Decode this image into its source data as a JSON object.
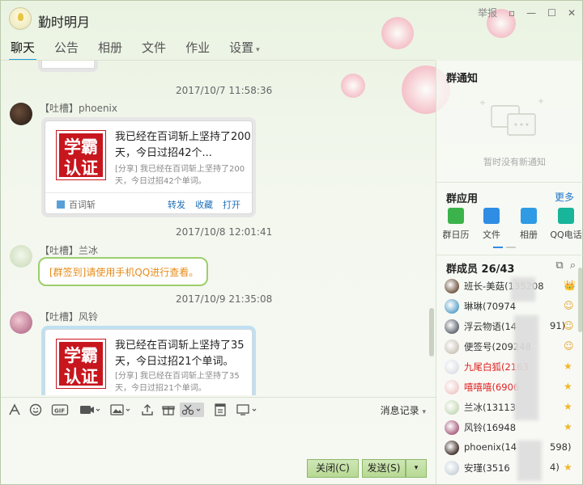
{
  "window": {
    "title": "勤时明月",
    "report_label": "举报",
    "ctrl_skin": "▫",
    "ctrl_min": "—",
    "ctrl_max": "☐",
    "ctrl_close": "✕"
  },
  "tabs": [
    {
      "label": "聊天"
    },
    {
      "label": "公告"
    },
    {
      "label": "相册"
    },
    {
      "label": "文件"
    },
    {
      "label": "作业"
    },
    {
      "label": "设置",
      "caret": "▾"
    }
  ],
  "messages": [
    {
      "time": "2017/10/7 11:58:36",
      "sender": "【吐槽】phoenix",
      "card": {
        "badge": "学霸认证",
        "headline": "我已经在百词斩上坚持了200天，今日过招42个...",
        "sub": "[分享] 我已经在百词斩上坚持了200天，今日过招42个单词。",
        "app": "百词斩",
        "actions": [
          "转发",
          "收藏",
          "打开"
        ]
      }
    },
    {
      "time": "2017/10/8 12:01:41",
      "sender": "【吐槽】兰冰",
      "text": "[群签到]请使用手机QQ进行查看。"
    },
    {
      "time": "2017/10/9 21:35:08",
      "sender": "【吐槽】风铃",
      "card": {
        "badge": "学霸认证",
        "headline": "我已经在百词斩上坚持了35天，今日过招21个单词。",
        "sub": "[分享] 我已经在百词斩上坚持了35天，今日过招21个单词。"
      }
    }
  ],
  "toolbar": {
    "history_label": "消息记录",
    "caret": "▾",
    "icons": [
      "font-icon",
      "emoji-icon",
      "gif-icon",
      "voice-icon",
      "image-icon",
      "upload-icon",
      "gift-icon",
      "scissors-icon",
      "doc-icon",
      "screen-icon"
    ]
  },
  "actions": {
    "close_label": "关闭(C)",
    "send_label": "发送(S)",
    "send_caret": "▾"
  },
  "notice": {
    "title": "群通知",
    "empty": "暂时没有新通知"
  },
  "apps": {
    "title": "群应用",
    "more": "更多",
    "items": [
      {
        "label": "群日历",
        "color": "#3bb34a"
      },
      {
        "label": "文件",
        "color": "#2f8de4"
      },
      {
        "label": "相册",
        "color": "#2f9be4"
      },
      {
        "label": "QQ电话",
        "color": "#18b59a"
      }
    ]
  },
  "members": {
    "title": "群成员 26/43",
    "list": [
      {
        "name": "班长-美菇(135208",
        "role": "👑",
        "red": false,
        "av": "#6b4e3a"
      },
      {
        "name": "琳琳(70974",
        "role": "☺",
        "red": false,
        "av": "#58a0c8"
      },
      {
        "name": "浮云物语(14",
        "suffix": "91)",
        "role": "☺",
        "red": false,
        "av": "#5a5f6a"
      },
      {
        "name": "便签号(209248",
        "role": "☺",
        "red": false,
        "av": "#c9c2b6"
      },
      {
        "name": "九尾白狐(2163",
        "role": "★",
        "red": true,
        "av": "#dcdfe6"
      },
      {
        "name": "嘻嘻嘻(6906",
        "role": "★",
        "red": true,
        "av": "#f0c8c8"
      },
      {
        "name": "兰冰(13113",
        "role": "★",
        "red": false,
        "av": "#c6d9b6"
      },
      {
        "name": "风铃(16948",
        "role": "★",
        "red": false,
        "av": "#a85a7a"
      },
      {
        "name": "phoenix(14",
        "suffix": "598)",
        "role": "",
        "red": false,
        "av": "#3a2a22"
      },
      {
        "name": "安瑾(3516",
        "suffix": "4)",
        "role": "★",
        "red": false,
        "av": "#c8d2da"
      }
    ]
  }
}
